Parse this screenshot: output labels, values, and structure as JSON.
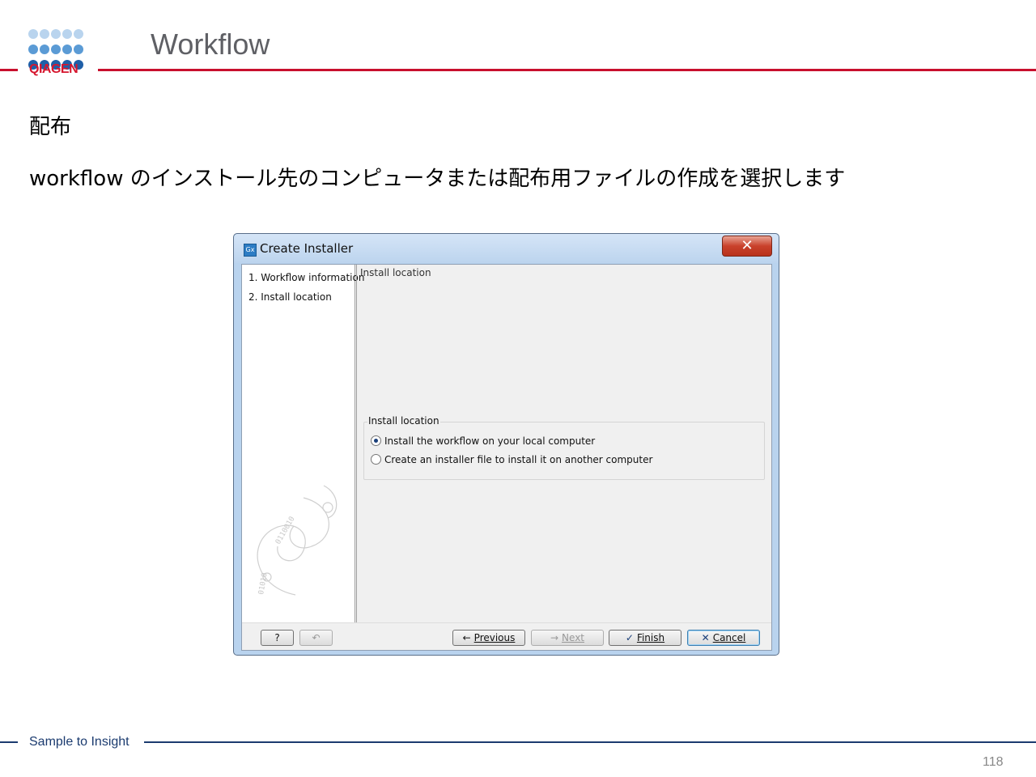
{
  "slide": {
    "title": "Workflow",
    "logo_text": "QIAGEN",
    "heading": "配布",
    "description": "workflow のインストール先のコンピュータまたは配布用ファイルの作成を選択します",
    "footer_tagline": "Sample to Insight",
    "page_number": "118",
    "colors": {
      "brand_red": "#c8102e",
      "brand_navy": "#1b3b6f"
    }
  },
  "dialog": {
    "title": "Create Installer",
    "app_icon": "Gx",
    "close_glyph": "✕",
    "steps": [
      "1. Workflow information",
      "2. Install location"
    ],
    "panel_title": "Install location",
    "group_label": "Install location",
    "options": [
      {
        "label": "Install the workflow on your local computer",
        "selected": true
      },
      {
        "label": "Create an installer file to install it on another computer",
        "selected": false
      }
    ],
    "buttons": {
      "help": "?",
      "reset": "↶",
      "previous": "Previous",
      "next": "Next",
      "finish": "Finish",
      "cancel": "Cancel"
    }
  }
}
